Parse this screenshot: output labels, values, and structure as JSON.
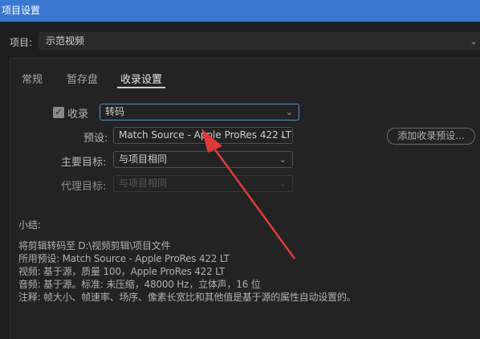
{
  "window": {
    "title": "项目设置"
  },
  "project": {
    "label": "项目:",
    "value": "示范视频"
  },
  "tabs": [
    {
      "label": "常规"
    },
    {
      "label": "暂存盘"
    },
    {
      "label": "收录设置"
    }
  ],
  "ingest": {
    "checkbox_label": "收录",
    "checked": true,
    "mode_value": "转码",
    "preset_label": "预设:",
    "preset_value": "Match Source - Apple ProRes 422 LT",
    "primary_label": "主要目标:",
    "primary_value": "与项目相同",
    "proxy_label": "代理目标:",
    "proxy_value": "与项目相同",
    "add_preset_button": "添加收录预设..."
  },
  "summary": {
    "title": "小结:",
    "lines": [
      "将剪辑转码至 D:\\视频剪辑\\项目文件",
      "所用预设: Match Source - Apple ProRes 422 LT",
      "视频: 基于源，质量 100，Apple ProRes 422 LT",
      "音频: 基于源。标准: 未压缩，48000 Hz，立体声，16 位",
      "注释: 帧大小、帧速率、场序、像素长宽比和其他值是基于源的属性自动设置的。"
    ]
  },
  "colors": {
    "accent": "#3a78d0",
    "annotation_arrow": "#e03b3b"
  }
}
